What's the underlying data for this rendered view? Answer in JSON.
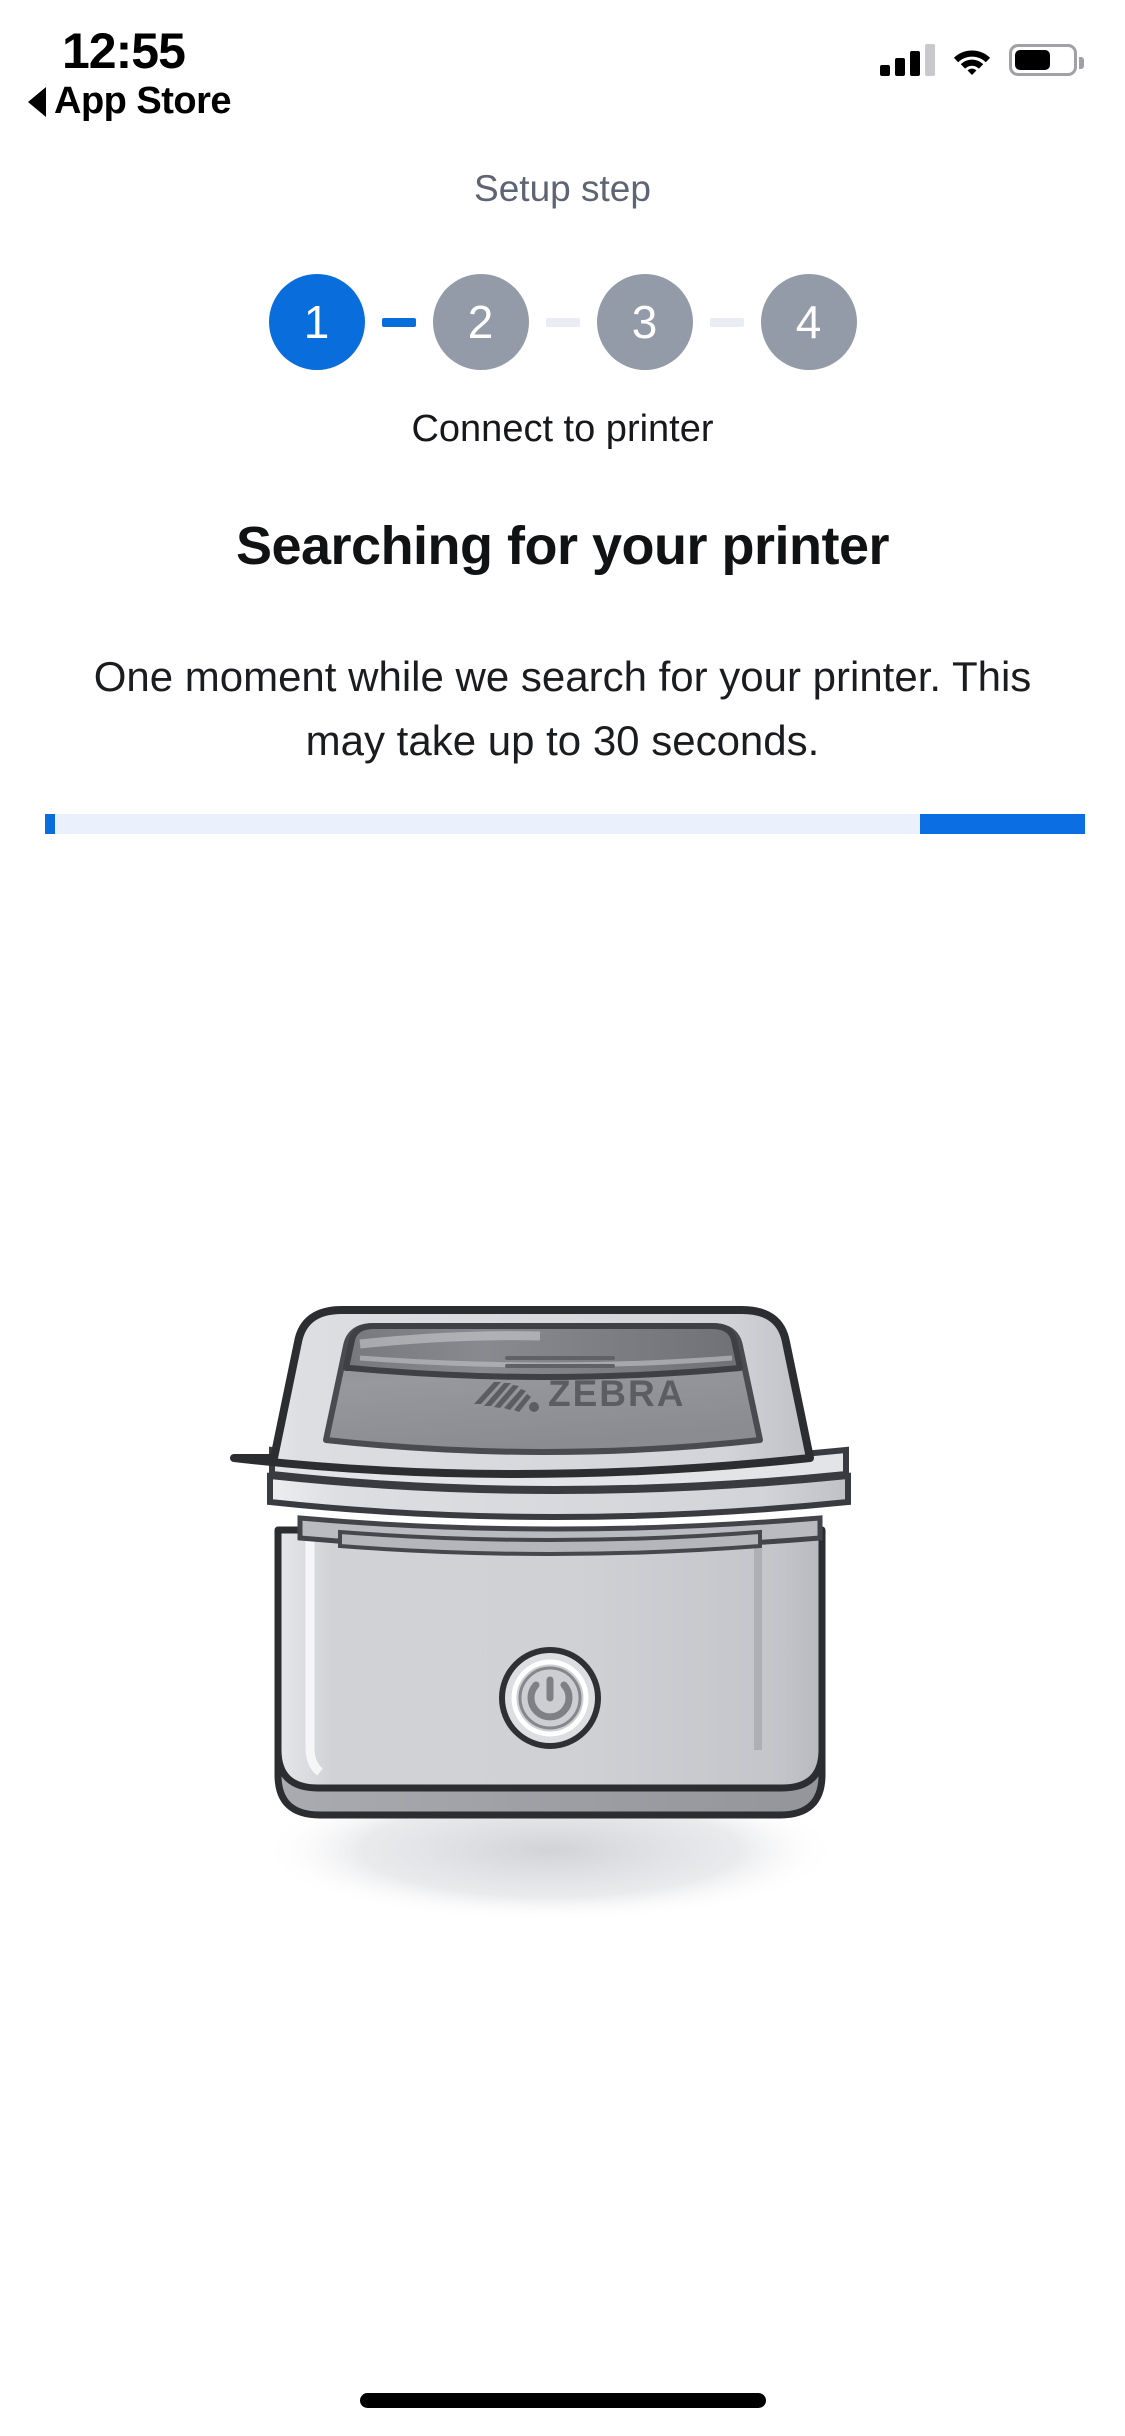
{
  "status_bar": {
    "time": "12:55",
    "back_label": "App Store",
    "back_icon": "caret-left-icon",
    "cellular_icon": "cellular-signal-icon",
    "cellular_bars_filled": 3,
    "cellular_bars_total": 4,
    "wifi_icon": "wifi-icon",
    "battery_icon": "battery-icon",
    "battery_percent": 60
  },
  "setup": {
    "section_label": "Setup step",
    "steps": [
      {
        "number": "1",
        "state": "active"
      },
      {
        "number": "2",
        "state": "inactive"
      },
      {
        "number": "3",
        "state": "inactive"
      },
      {
        "number": "4",
        "state": "inactive"
      }
    ],
    "connectors": [
      "done",
      "todo",
      "todo"
    ],
    "step_caption": "Connect to printer"
  },
  "main": {
    "title": "Searching for your printer",
    "body": "One moment while we search for your printer. This may take up to 30 seconds.",
    "progress": {
      "indeterminate": true,
      "fill_percent": 16
    },
    "illustration": {
      "name": "zebra-printer-illustration",
      "brand_text": "ZEBRA",
      "power_button_icon": "power-icon"
    }
  },
  "colors": {
    "accent_blue": "#0a6ddc",
    "progress_fill": "#0b6fe3",
    "progress_track": "#eaf1fc",
    "step_inactive": "#939aa8",
    "connector_todo": "#e9ecf2",
    "label_grey": "#5d6472",
    "text_dark": "#17181b"
  },
  "home_indicator": {
    "name": "home-indicator"
  }
}
